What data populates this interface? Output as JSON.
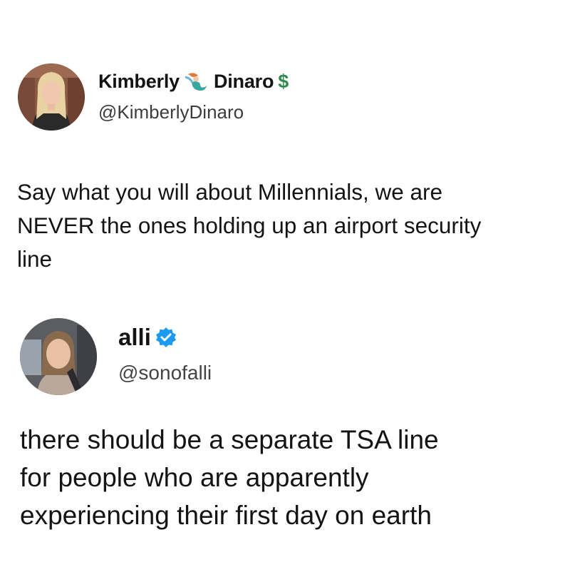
{
  "tweets": [
    {
      "display_name_first": "Kimberly",
      "display_name_emoji": "mermaid-icon",
      "display_name_last": "Dinaro",
      "display_name_symbol": "$",
      "handle": "@KimberlyDinaro",
      "text": "Say what you will about Millennials, we are\nNEVER the ones holding up an airport security\nline"
    },
    {
      "display_name": "alli",
      "badge": "verified-badge-icon",
      "handle": "@sonofalli",
      "text": "there should be a separate TSA line\nfor people who are apparently\nexperiencing their first day on earth"
    }
  ],
  "colors": {
    "background": "#ffffff",
    "text": "#141414",
    "handle": "#3c3c3c",
    "verified": "#1d9bf0",
    "dollar": "#2f8a4b"
  }
}
